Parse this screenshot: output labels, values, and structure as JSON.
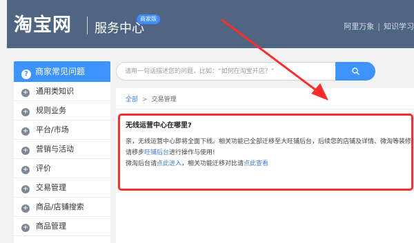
{
  "header": {
    "logo": "淘宝网",
    "service_title": "服务中心",
    "badge": "商家版",
    "links": [
      "阿里万象",
      "知识学习"
    ]
  },
  "sidebar": {
    "title": "商家常见问题",
    "items": [
      {
        "label": "通用类知识"
      },
      {
        "label": "规则业务"
      },
      {
        "label": "平台/市场"
      },
      {
        "label": "营销与活动"
      },
      {
        "label": "评价"
      },
      {
        "label": "交易管理"
      },
      {
        "label": "商品/店铺搜索"
      },
      {
        "label": "商品管理"
      }
    ]
  },
  "search": {
    "placeholder": "请用一句话描述您的问题，比如：“如何在淘宝开店？”"
  },
  "breadcrumb": {
    "home": "全部",
    "separator": ">",
    "current": "交易管理"
  },
  "article": {
    "question": "无线运营中心在哪里?",
    "line1": "亲，无线运营中心即将全面下线。相关功能已全部迁移至大旺铺后台，后续您的店铺及详情、微淘等装修",
    "line2_pre": "请移步",
    "line2_link": "旺铺后台",
    "line2_post": "进行操作与使用!",
    "line3_pre": "微淘后台请",
    "line3_link1": "点此进入",
    "line3_mid": "，相关功能迁移对比请",
    "line3_link2": "点此查看"
  },
  "colors": {
    "header_bg": "#506581",
    "accent": "#3f93ff",
    "annotation": "#ff2a2a"
  }
}
